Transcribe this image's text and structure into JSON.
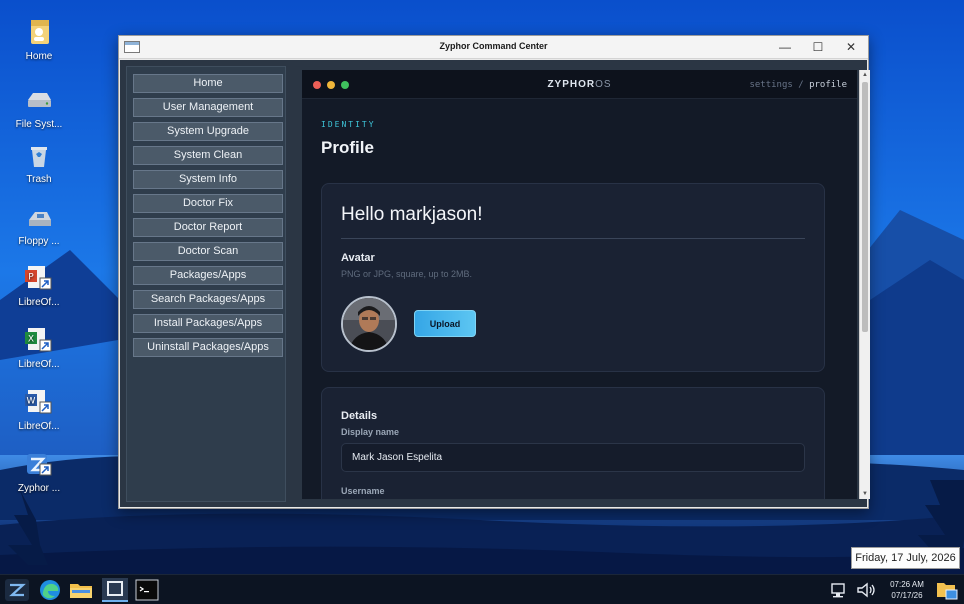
{
  "desktop": {
    "icons": [
      {
        "label": "Home",
        "icon": "home-folder-icon"
      },
      {
        "label": "File Syst...",
        "icon": "drive-icon"
      },
      {
        "label": "Trash",
        "icon": "trash-icon"
      },
      {
        "label": "Floppy ...",
        "icon": "floppy-icon"
      },
      {
        "label": "LibreOf...",
        "icon": "impress-shortcut-icon"
      },
      {
        "label": "LibreOf...",
        "icon": "calc-shortcut-icon"
      },
      {
        "label": "LibreOf...",
        "icon": "writer-shortcut-icon"
      },
      {
        "label": "Zyphor ...",
        "icon": "zyphor-shortcut-icon"
      }
    ]
  },
  "window": {
    "title": "Zyphor Command Center",
    "controls": {
      "minimize": "—",
      "maximize": "☐",
      "close": "✕"
    }
  },
  "nav": {
    "items": [
      "Home",
      "User Management",
      "System Upgrade",
      "System Clean",
      "System Info",
      "Doctor Fix",
      "Doctor Report",
      "Doctor Scan",
      "Packages/Apps",
      "Search Packages/Apps",
      "Install Packages/Apps",
      "Uninstall Packages/Apps"
    ]
  },
  "web": {
    "brand_main": "ZYPHOR",
    "brand_suffix": "OS",
    "breadcrumb_parent": "settings",
    "breadcrumb_sep": "/",
    "breadcrumb_current": "profile",
    "eyebrow": "IDENTITY",
    "page_title": "Profile",
    "greeting": "Hello markjason!",
    "avatar_heading": "Avatar",
    "avatar_hint": "PNG or JPG, square, up to 2MB.",
    "upload_label": "Upload",
    "details_heading": "Details",
    "display_name_label": "Display name",
    "display_name_value": "Mark Jason Espelita",
    "username_label": "Username"
  },
  "taskbar": {
    "time": "07:26 AM",
    "date": "07/17/26",
    "tooltip": "Friday, 17 July, 2026"
  },
  "colors": {
    "accent": "#3ec5d8",
    "traffic_red": "#ec5f57",
    "traffic_yellow": "#f0b63a",
    "traffic_green": "#3fc15e"
  }
}
